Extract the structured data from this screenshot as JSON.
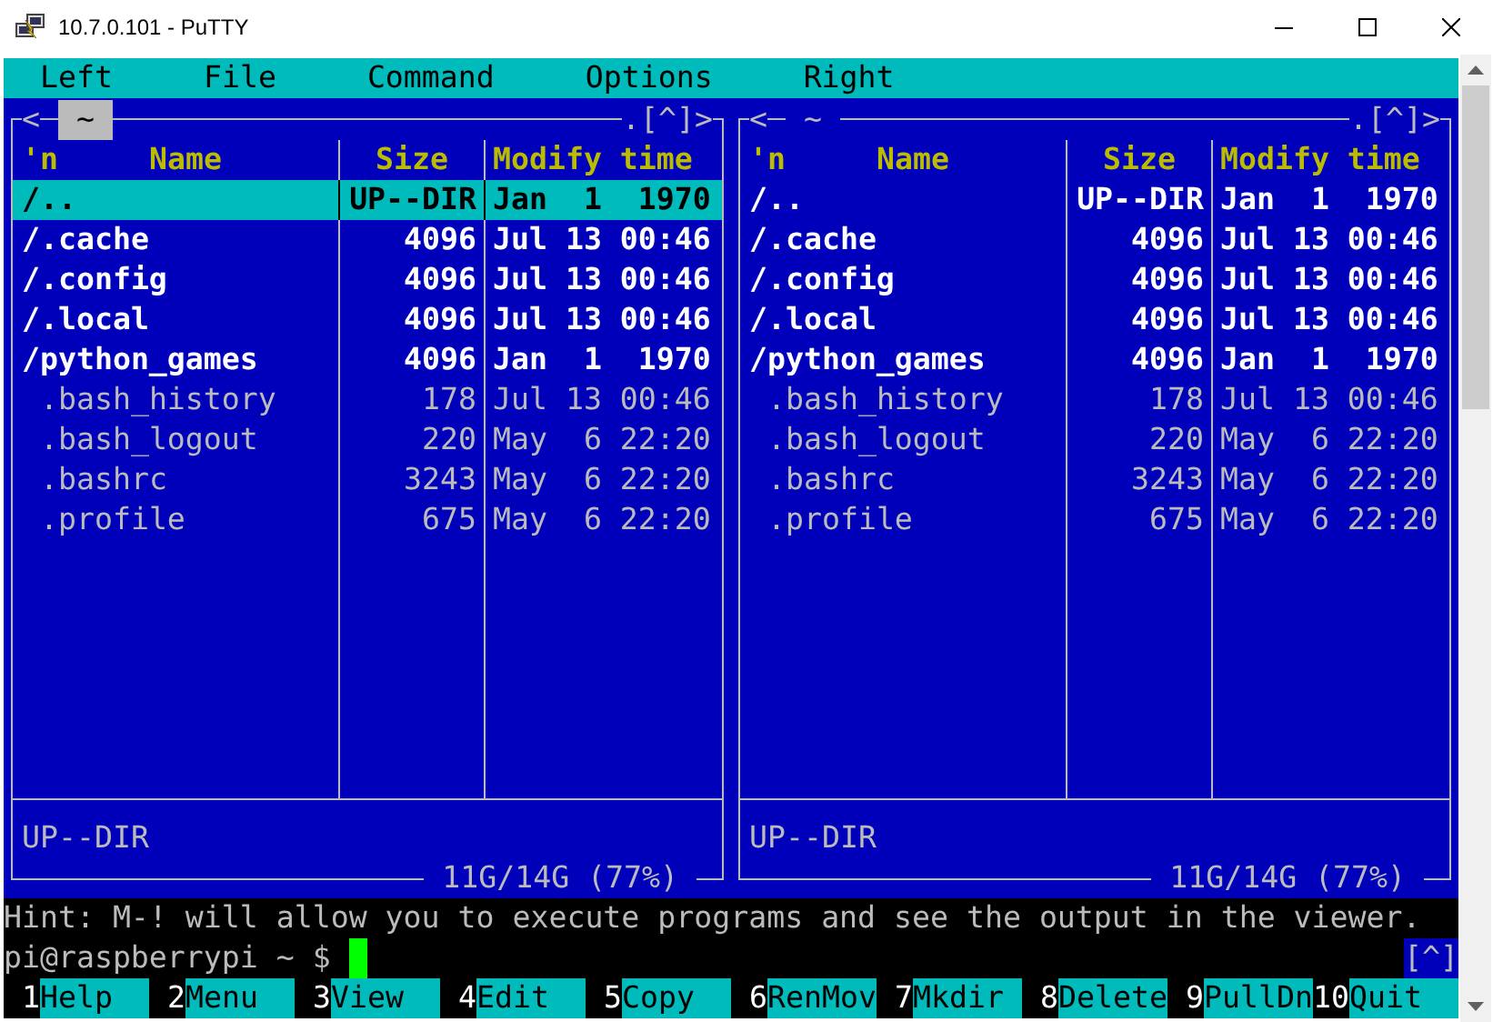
{
  "window": {
    "title": "10.7.0.101 - PuTTY"
  },
  "menu_bar": [
    {
      "label": "Left"
    },
    {
      "label": "File"
    },
    {
      "label": "Command"
    },
    {
      "label": "Options"
    },
    {
      "label": "Right"
    }
  ],
  "panels": [
    {
      "active": true,
      "nav_left": "<",
      "path": "~",
      "controls": ".[^]>",
      "header": {
        "sort_marker": "'n",
        "name": "Name",
        "size": "Size",
        "time": "Modify time"
      },
      "files": [
        {
          "kind": "dir",
          "name": "/..",
          "size": "UP--DIR",
          "time": "Jan  1  1970",
          "selected": true
        },
        {
          "kind": "dir",
          "name": "/.cache",
          "size": "4096",
          "time": "Jul 13 00:46",
          "selected": false
        },
        {
          "kind": "dir",
          "name": "/.config",
          "size": "4096",
          "time": "Jul 13 00:46",
          "selected": false
        },
        {
          "kind": "dir",
          "name": "/.local",
          "size": "4096",
          "time": "Jul 13 00:46",
          "selected": false
        },
        {
          "kind": "dir",
          "name": "/python_games",
          "size": "4096",
          "time": "Jan  1  1970",
          "selected": false
        },
        {
          "kind": "file",
          "name": ".bash_history",
          "size": "178",
          "time": "Jul 13 00:46",
          "selected": false
        },
        {
          "kind": "file",
          "name": ".bash_logout",
          "size": "220",
          "time": "May  6 22:20",
          "selected": false
        },
        {
          "kind": "file",
          "name": ".bashrc",
          "size": "3243",
          "time": "May  6 22:20",
          "selected": false
        },
        {
          "kind": "file",
          "name": ".profile",
          "size": "675",
          "time": "May  6 22:20",
          "selected": false
        }
      ],
      "mini_status": "UP--DIR",
      "disk_usage": "11G/14G (77%)"
    },
    {
      "active": false,
      "nav_left": "<",
      "path": "~",
      "controls": ".[^]>",
      "header": {
        "sort_marker": "'n",
        "name": "Name",
        "size": "Size",
        "time": "Modify time"
      },
      "files": [
        {
          "kind": "dir",
          "name": "/..",
          "size": "UP--DIR",
          "time": "Jan  1  1970",
          "selected": false
        },
        {
          "kind": "dir",
          "name": "/.cache",
          "size": "4096",
          "time": "Jul 13 00:46",
          "selected": false
        },
        {
          "kind": "dir",
          "name": "/.config",
          "size": "4096",
          "time": "Jul 13 00:46",
          "selected": false
        },
        {
          "kind": "dir",
          "name": "/.local",
          "size": "4096",
          "time": "Jul 13 00:46",
          "selected": false
        },
        {
          "kind": "dir",
          "name": "/python_games",
          "size": "4096",
          "time": "Jan  1  1970",
          "selected": false
        },
        {
          "kind": "file",
          "name": ".bash_history",
          "size": "178",
          "time": "Jul 13 00:46",
          "selected": false
        },
        {
          "kind": "file",
          "name": ".bash_logout",
          "size": "220",
          "time": "May  6 22:20",
          "selected": false
        },
        {
          "kind": "file",
          "name": ".bashrc",
          "size": "3243",
          "time": "May  6 22:20",
          "selected": false
        },
        {
          "kind": "file",
          "name": ".profile",
          "size": "675",
          "time": "May  6 22:20",
          "selected": false
        }
      ],
      "mini_status": "UP--DIR",
      "disk_usage": "11G/14G (77%)"
    }
  ],
  "hint": "Hint: M-! will allow you to execute programs and see the output in the viewer.",
  "prompt": "pi@raspberrypi ~ $",
  "history_button": "[^]",
  "function_keys": [
    {
      "number": "1",
      "label": "Help"
    },
    {
      "number": "2",
      "label": "Menu"
    },
    {
      "number": "3",
      "label": "View"
    },
    {
      "number": "4",
      "label": "Edit"
    },
    {
      "number": "5",
      "label": "Copy"
    },
    {
      "number": "6",
      "label": "RenMov"
    },
    {
      "number": "7",
      "label": "Mkdir"
    },
    {
      "number": "8",
      "label": "Delete"
    },
    {
      "number": "9",
      "label": "PullDn"
    },
    {
      "number": "10",
      "label": "Quit"
    }
  ]
}
